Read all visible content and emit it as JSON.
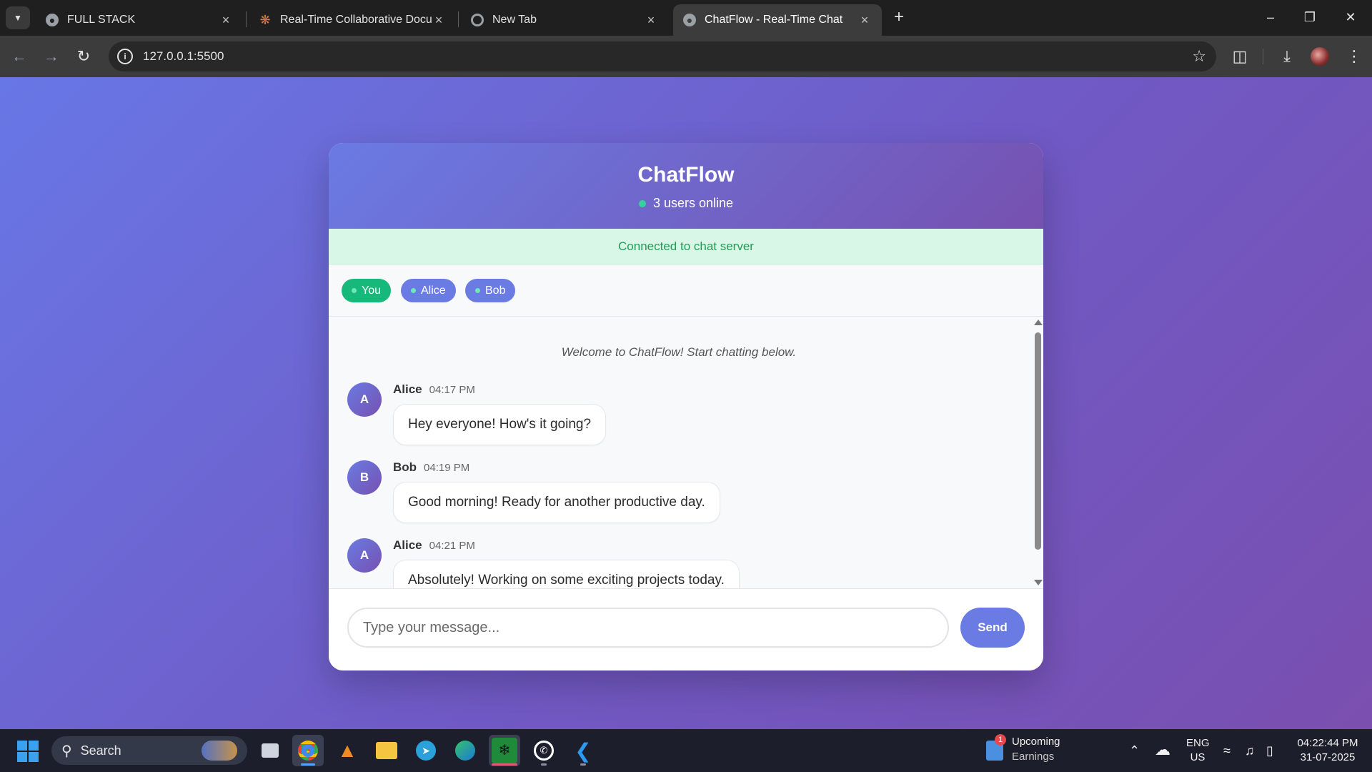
{
  "browser": {
    "tabs": [
      {
        "title": "FULL STACK",
        "active": false,
        "icon": "globe-icon"
      },
      {
        "title": "Real-Time Collaborative Docum",
        "active": false,
        "icon": "claude-spark-icon"
      },
      {
        "title": "New Tab",
        "active": false,
        "icon": "chrome-icon"
      },
      {
        "title": "ChatFlow - Real-Time Chat",
        "active": true,
        "icon": "globe-icon"
      }
    ],
    "url": "127.0.0.1:5500"
  },
  "chat": {
    "title": "ChatFlow",
    "online_text": "3 users online",
    "connection_status": "Connected to chat server",
    "users": [
      "You",
      "Alice",
      "Bob"
    ],
    "welcome": "Welcome to ChatFlow! Start chatting below.",
    "messages": [
      {
        "initial": "A",
        "sender": "Alice",
        "time": "04:17 PM",
        "text": "Hey everyone! How's it going?"
      },
      {
        "initial": "B",
        "sender": "Bob",
        "time": "04:19 PM",
        "text": "Good morning! Ready for another productive day."
      },
      {
        "initial": "A",
        "sender": "Alice",
        "time": "04:21 PM",
        "text": "Absolutely! Working on some exciting projects today."
      }
    ],
    "input_placeholder": "Type your message...",
    "send_label": "Send"
  },
  "taskbar": {
    "search_label": "Search",
    "weather_title": "Upcoming",
    "weather_sub": "Earnings",
    "weather_badge": "1",
    "lang_top": "ENG",
    "lang_bottom": "US",
    "clock_time": "04:22:44 PM",
    "clock_date": "31-07-2025"
  },
  "colors": {
    "accent": "#6a7be3",
    "header_end": "#7651b0",
    "online_green": "#16b97a",
    "banner_bg": "#d9f7e6",
    "banner_text": "#1f9d57"
  }
}
